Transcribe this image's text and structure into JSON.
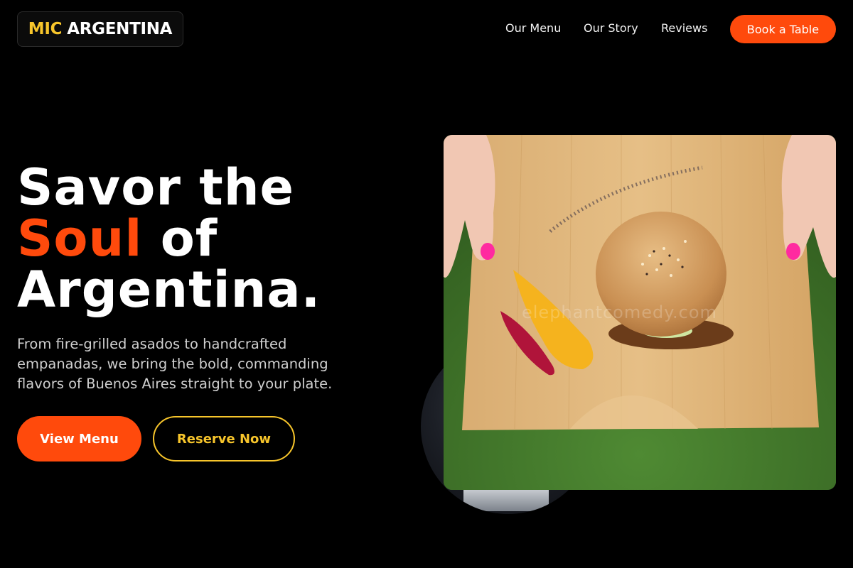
{
  "header": {
    "logo_part1": "MIC",
    "logo_part2": "ARGENTINA",
    "nav": {
      "menu": "Our Menu",
      "story": "Our Story",
      "reviews": "Reviews"
    },
    "cta": "Book a Table"
  },
  "hero": {
    "headline_line1": "Savor the",
    "headline_accent": "Soul",
    "headline_line2_rest": " of",
    "headline_line3": "Argentina.",
    "subtext": "From fire-grilled asados to handcrafted empanadas, we bring the bold, commanding flavors of Buenos Aires straight to your plate.",
    "primary_button": "View Menu",
    "secondary_button": "Reserve Now",
    "image_watermark": "elephantcomedy.com"
  },
  "colors": {
    "background": "#000000",
    "accent_orange": "#ff4a0c",
    "accent_yellow": "#f7c52b",
    "text_muted": "#cfcfcf"
  }
}
